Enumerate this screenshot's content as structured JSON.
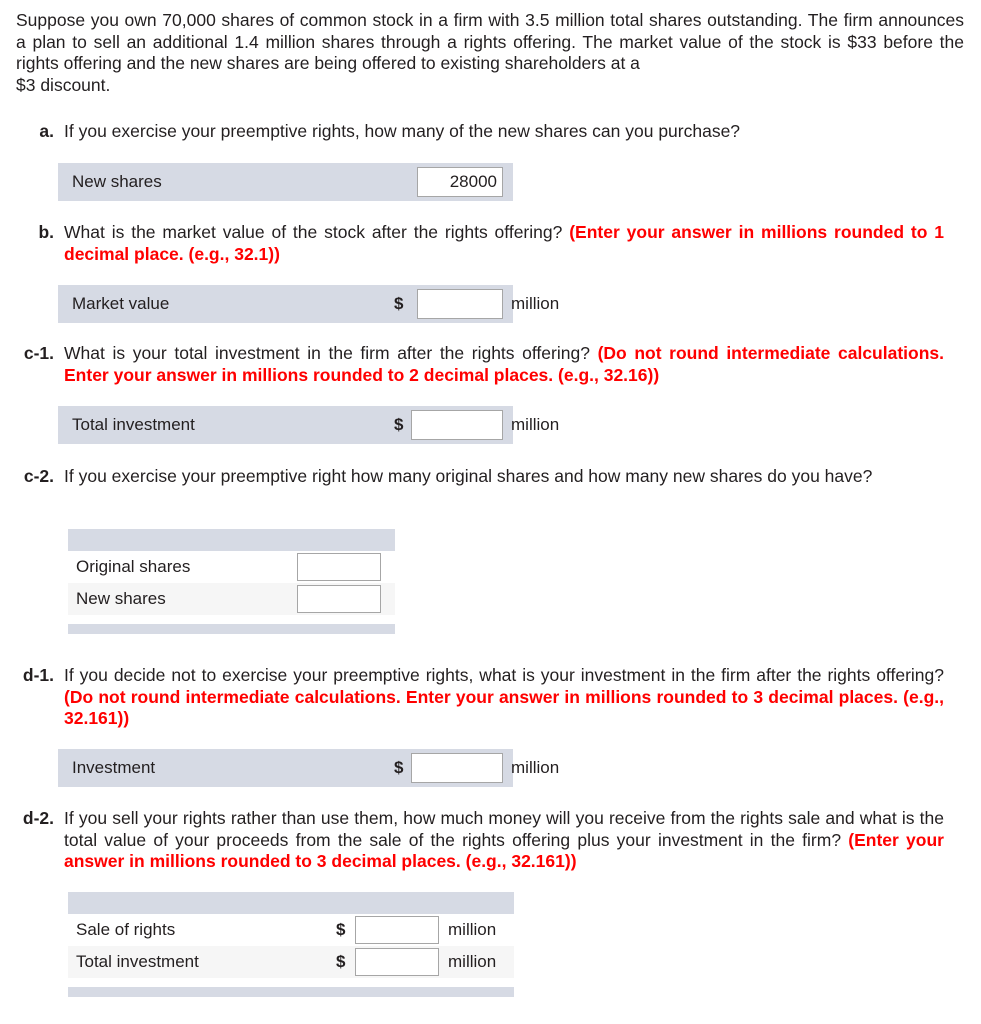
{
  "intro": {
    "text": "Suppose you own 70,000 shares of common stock in a firm with 3.5 million total shares outstanding. The firm announces a plan to sell an additional 1.4 million shares through a rights offering. The market value of the stock is $33 before the rights offering and the new shares are being offered to existing shareholders at a",
    "last_line": "$3 discount."
  },
  "colors": {
    "band": "#d6dae4",
    "row_alt": "#f6f6f6",
    "instruction_red": "#ff0000",
    "text": "#231f20",
    "input_border": "#a6a6a6"
  },
  "questions": [
    {
      "label": "a.",
      "text": "If you exercise your preemptive rights, how many of the new shares can you purchase?",
      "instruction": "",
      "answer": {
        "type": "band",
        "row_label": "New shares",
        "prefix": "",
        "value": "28000",
        "unit": ""
      }
    },
    {
      "label": "b.",
      "text": "What is the market value of the stock after the rights offering? ",
      "instruction": "(Enter your answer in millions rounded to 1 decimal place. (e.g., 32.1))",
      "answer": {
        "type": "band",
        "row_label": "Market value",
        "prefix": "$",
        "value": "",
        "unit": "million"
      }
    },
    {
      "label": "c-1.",
      "text": "What is your total investment in the firm after the rights offering? ",
      "instruction": "(Do not round intermediate calculations. Enter your answer in millions rounded to 2 decimal places. (e.g., 32.16))",
      "answer": {
        "type": "band",
        "row_label": "Total investment",
        "prefix": "$",
        "value": "",
        "unit": "million"
      }
    },
    {
      "label": "c-2.",
      "text": "If you exercise your preemptive right how many original shares and how many new shares do you have?",
      "instruction": "",
      "answer": {
        "type": "table",
        "rows": [
          {
            "row_label": "Original shares",
            "prefix": "",
            "value": "",
            "unit": ""
          },
          {
            "row_label": "New shares",
            "prefix": "",
            "value": "",
            "unit": ""
          }
        ]
      }
    },
    {
      "label": "d-1.",
      "text": "If you decide not to exercise your preemptive rights, what is your investment in the firm after the rights offering? ",
      "instruction": "(Do not round intermediate calculations. Enter your answer in millions rounded to 3 decimal places. (e.g., 32.161))",
      "answer": {
        "type": "band",
        "row_label": "Investment",
        "prefix": "$",
        "value": "",
        "unit": "million"
      }
    },
    {
      "label": "d-2.",
      "text": "If you sell your rights rather than use them, how much money will you receive from the rights sale and what is the total value of your proceeds from the sale of the rights offering plus your investment in the firm? ",
      "instruction": "(Enter your answer in millions rounded to 3 decimal places. (e.g., 32.161))",
      "answer": {
        "type": "table",
        "rows": [
          {
            "row_label": "Sale of rights",
            "prefix": "$",
            "value": "",
            "unit": "million"
          },
          {
            "row_label": "Total investment",
            "prefix": "$",
            "value": "",
            "unit": "million"
          }
        ]
      }
    }
  ]
}
